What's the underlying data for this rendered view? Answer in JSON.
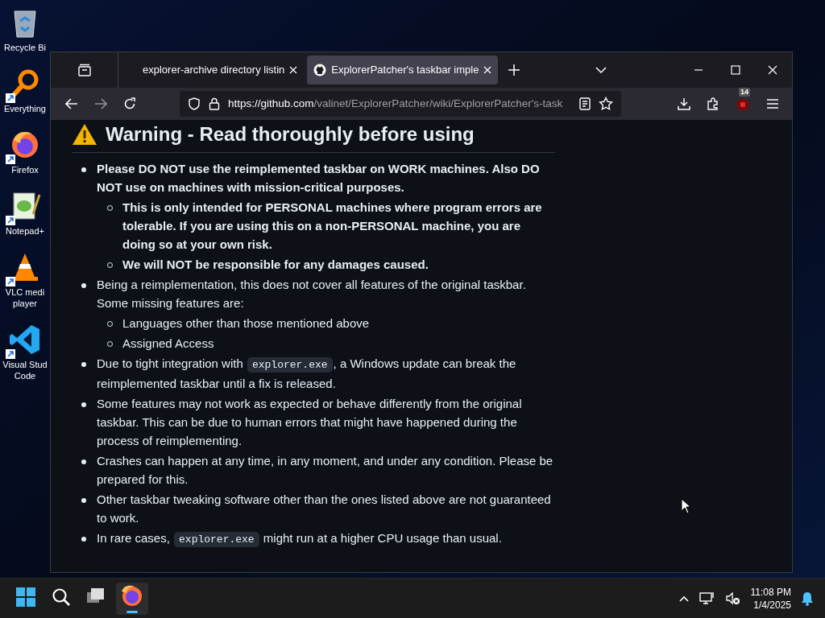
{
  "desktop_icons": [
    {
      "label": "Recycle Bi",
      "kind": "recycle",
      "shortcut": false
    },
    {
      "label": "Everything",
      "kind": "everything",
      "shortcut": true
    },
    {
      "label": "Firefox",
      "kind": "firefox",
      "shortcut": true
    },
    {
      "label": "Notepad+",
      "kind": "notepad",
      "shortcut": true
    },
    {
      "label": "VLC medi player",
      "kind": "vlc",
      "shortcut": true
    },
    {
      "label": "Visual Stud Code",
      "kind": "vscode",
      "shortcut": true
    }
  ],
  "browser": {
    "tabs": [
      {
        "title": "explorer-archive directory listin",
        "selected": false,
        "favicon": false
      },
      {
        "title": "ExplorerPatcher's taskbar imple",
        "selected": true,
        "favicon": true
      }
    ],
    "url_host": "https://github.com",
    "url_path": "/valinet/ExplorerPatcher/wiki/ExplorerPatcher's-task",
    "extension_badge": "14"
  },
  "article": {
    "heading": "Warning - Read thoroughly before using",
    "items": [
      {
        "bold": true,
        "parts": [
          {
            "kind": "text",
            "text": "Please DO NOT use the reimplemented taskbar on WORK machines. Also DO NOT use on machines with mission-critical purposes."
          }
        ],
        "children": [
          {
            "bold": true,
            "parts": [
              {
                "kind": "text",
                "text": "This is only intended for PERSONAL machines where program errors are tolerable. If you are using this on a non-PERSONAL machine, you are doing so at your own risk."
              }
            ]
          },
          {
            "bold": true,
            "parts": [
              {
                "kind": "text",
                "text": "We will NOT be responsible for any damages caused."
              }
            ]
          }
        ]
      },
      {
        "bold": false,
        "parts": [
          {
            "kind": "text",
            "text": "Being a reimplementation, this does not cover all features of the original taskbar. Some missing features are:"
          }
        ],
        "children": [
          {
            "bold": false,
            "parts": [
              {
                "kind": "text",
                "text": "Languages other than those mentioned above"
              }
            ]
          },
          {
            "bold": false,
            "parts": [
              {
                "kind": "text",
                "text": "Assigned Access"
              }
            ]
          }
        ]
      },
      {
        "bold": false,
        "parts": [
          {
            "kind": "text",
            "text": "Due to tight integration with "
          },
          {
            "kind": "code",
            "text": "explorer.exe"
          },
          {
            "kind": "text",
            "text": ", a Windows update can break the reimplemented taskbar until a fix is released."
          }
        ]
      },
      {
        "bold": false,
        "parts": [
          {
            "kind": "text",
            "text": "Some features may not work as expected or behave differently from the original taskbar. This can be due to human errors that might have happened during the process of reimplementing."
          }
        ]
      },
      {
        "bold": false,
        "parts": [
          {
            "kind": "text",
            "text": "Crashes can happen at any time, in any moment, and under any condition. Please be prepared for this."
          }
        ]
      },
      {
        "bold": false,
        "parts": [
          {
            "kind": "text",
            "text": "Other taskbar tweaking software other than the ones listed above are not guaranteed to work."
          }
        ]
      },
      {
        "bold": false,
        "parts": [
          {
            "kind": "text",
            "text": "In rare cases, "
          },
          {
            "kind": "code",
            "text": "explorer.exe"
          },
          {
            "kind": "text",
            "text": " might run at a higher CPU usage than usual."
          }
        ]
      }
    ]
  },
  "taskbar": {
    "apps": [
      {
        "kind": "start",
        "active": false
      },
      {
        "kind": "search",
        "active": false
      },
      {
        "kind": "taskview",
        "active": false
      },
      {
        "kind": "firefox",
        "active": true
      }
    ],
    "time": "11:08 PM",
    "date": "1/4/2025"
  }
}
